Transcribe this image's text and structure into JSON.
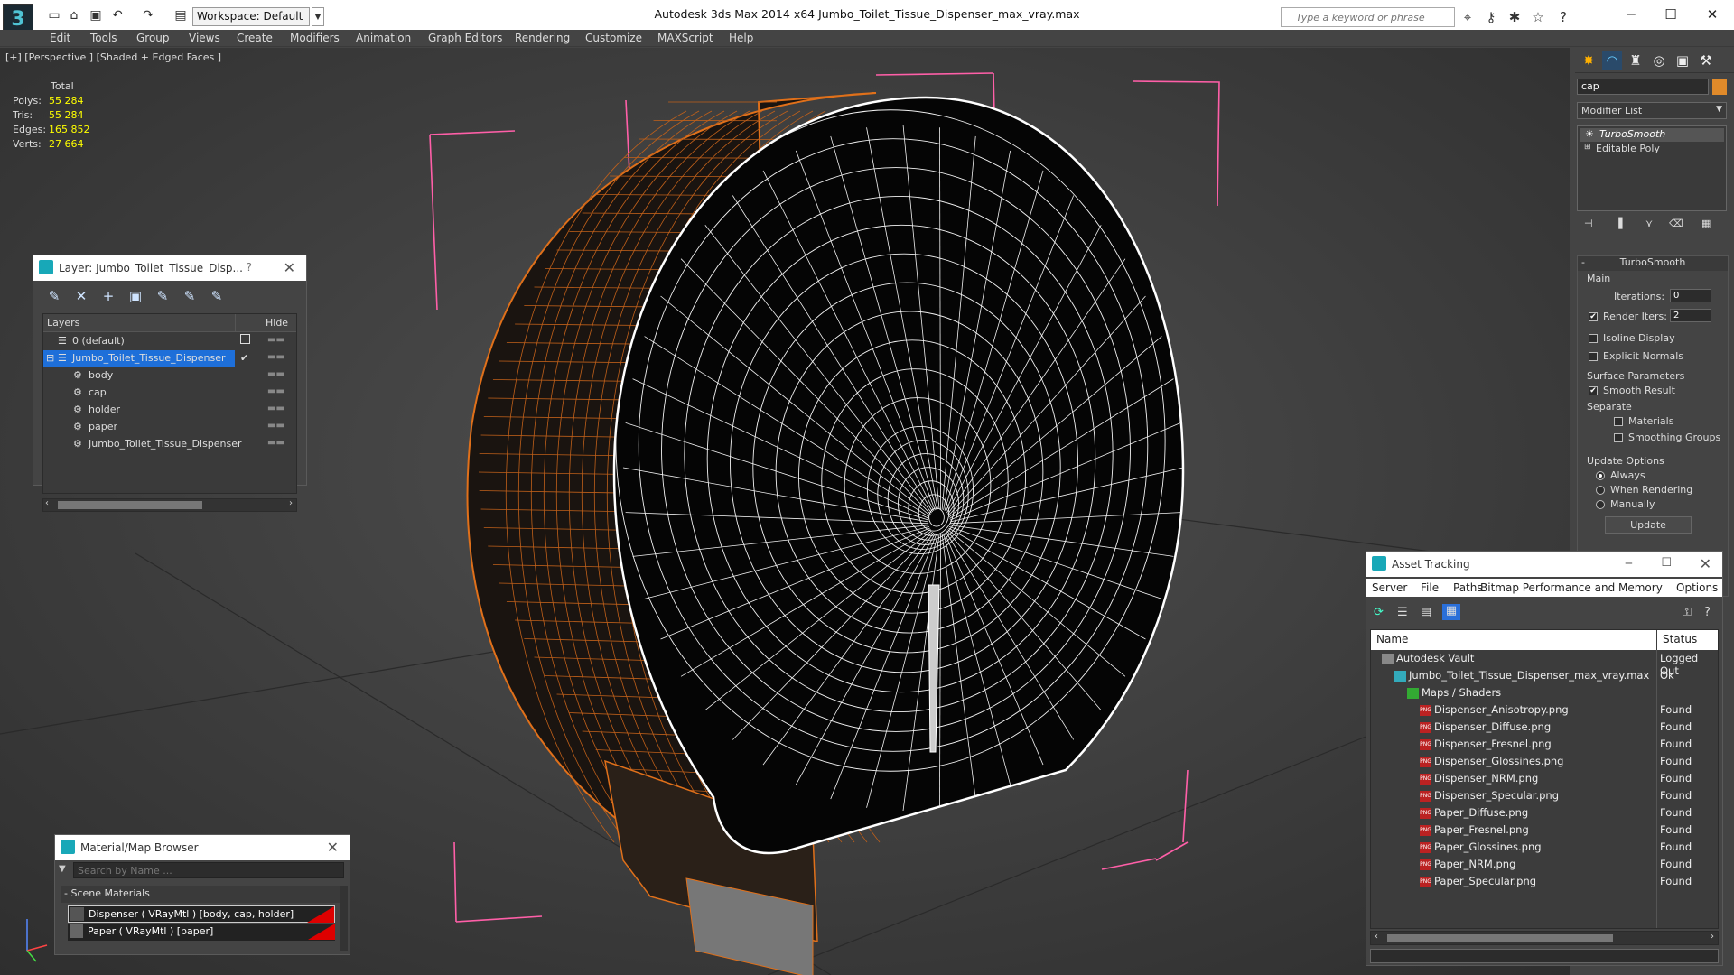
{
  "app": {
    "logo": "3",
    "workspace": "Workspace: Default",
    "window_title": "Autodesk 3ds Max  2014 x64      Jumbo_Toilet_Tissue_Dispenser_max_vray.max",
    "search_placeholder": "Type a keyword or phrase"
  },
  "menu": [
    "Edit",
    "Tools",
    "Group",
    "Views",
    "Create",
    "Modifiers",
    "Animation",
    "Graph Editors",
    "Rendering",
    "Customize",
    "MAXScript",
    "Help"
  ],
  "viewport": {
    "label": "[+] [Perspective ] [Shaded + Edged Faces ]",
    "stats": {
      "header": "Total",
      "rows": [
        {
          "k": "Polys:",
          "v": "55 284"
        },
        {
          "k": "Tris:",
          "v": "55 284"
        },
        {
          "k": "Edges:",
          "v": "165 852"
        },
        {
          "k": "Verts:",
          "v": "27 664"
        }
      ]
    }
  },
  "layer_panel": {
    "title": "Layer: Jumbo_Toilet_Tissue_Disp...",
    "help": "?",
    "col_layers": "Layers",
    "col_hide": "Hide",
    "rows": [
      "0 (default)",
      "Jumbo_Toilet_Tissue_Dispenser",
      "body",
      "cap",
      "holder",
      "paper",
      "Jumbo_Toilet_Tissue_Dispenser"
    ]
  },
  "material_browser": {
    "title": "Material/Map Browser",
    "search_placeholder": "Search by Name ...",
    "section": "- Scene Materials",
    "items": [
      "Dispenser  ( VRayMtl ) [body, cap, holder]",
      "Paper  ( VRayMtl ) [paper]"
    ]
  },
  "command_panel": {
    "name_field": "cap",
    "modifier_list": "Modifier List",
    "stack": [
      "TurboSmooth",
      "Editable Poly"
    ],
    "rollout_title": "TurboSmooth",
    "main": "Main",
    "iterations_label": "Iterations:",
    "iterations": "0",
    "render_iters_label": "Render Iters:",
    "render_iters": "2",
    "isoline": "Isoline Display",
    "explicit": "Explicit Normals",
    "surface_params": "Surface Parameters",
    "smooth_result": "Smooth Result",
    "separate": "Separate",
    "materials": "Materials",
    "smoothing_groups": "Smoothing Groups",
    "update_options": "Update Options",
    "always": "Always",
    "when_rendering": "When Rendering",
    "manually": "Manually",
    "update_btn": "Update"
  },
  "asset_tracking": {
    "title": "Asset Tracking",
    "menu": [
      "Server",
      "File",
      "Paths",
      "Bitmap Performance and Memory",
      "Options"
    ],
    "col_name": "Name",
    "col_status": "Status",
    "rows": [
      {
        "name": "Autodesk Vault",
        "status": "Logged Out",
        "indent": 0
      },
      {
        "name": "Jumbo_Toilet_Tissue_Dispenser_max_vray.max",
        "status": "Ok",
        "indent": 1
      },
      {
        "name": "Maps / Shaders",
        "status": "",
        "indent": 2
      },
      {
        "name": "Dispenser_Anisotropy.png",
        "status": "Found",
        "indent": 3
      },
      {
        "name": "Dispenser_Diffuse.png",
        "status": "Found",
        "indent": 3
      },
      {
        "name": "Dispenser_Fresnel.png",
        "status": "Found",
        "indent": 3
      },
      {
        "name": "Dispenser_Glossines.png",
        "status": "Found",
        "indent": 3
      },
      {
        "name": "Dispenser_NRM.png",
        "status": "Found",
        "indent": 3
      },
      {
        "name": "Dispenser_Specular.png",
        "status": "Found",
        "indent": 3
      },
      {
        "name": "Paper_Diffuse.png",
        "status": "Found",
        "indent": 3
      },
      {
        "name": "Paper_Fresnel.png",
        "status": "Found",
        "indent": 3
      },
      {
        "name": "Paper_Glossines.png",
        "status": "Found",
        "indent": 3
      },
      {
        "name": "Paper_NRM.png",
        "status": "Found",
        "indent": 3
      },
      {
        "name": "Paper_Specular.png",
        "status": "Found",
        "indent": 3
      }
    ]
  },
  "colors": {
    "selection": "#1e6fd9",
    "bbox": "#ff5fa8",
    "wire_orange": "#e0701a",
    "accent": "#18a8b8"
  }
}
